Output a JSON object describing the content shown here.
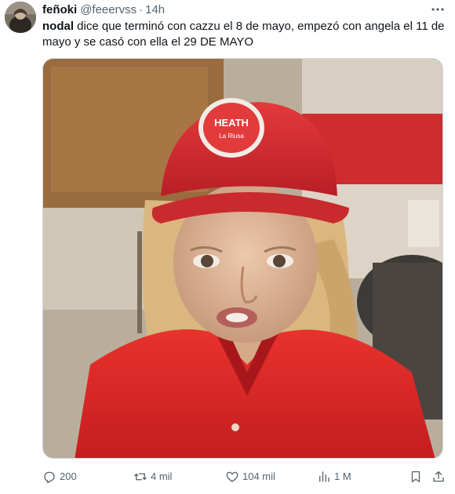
{
  "tweet": {
    "display_name": "feñoki",
    "handle": "@feeervss",
    "separator": "·",
    "time": "14h",
    "text_bold": "nodal",
    "text_rest": " dice que terminó con cazzu el 8 de mayo, empezó con angela el 11 de mayo y se casó con ella el 29 DE MAYO",
    "media_icon": "photo-meme",
    "cap_logo_line1": "HEATH",
    "cap_logo_line2": "La Riusa"
  },
  "actions": {
    "reply": {
      "icon": "reply-icon",
      "count": "200"
    },
    "repost": {
      "icon": "repost-icon",
      "count": "4 mil"
    },
    "like": {
      "icon": "heart-icon",
      "count": "104 mil"
    },
    "views": {
      "icon": "views-icon",
      "count": "1 M"
    },
    "bookmark": {
      "icon": "bookmark-icon"
    },
    "share": {
      "icon": "share-icon"
    }
  },
  "colors": {
    "text": "#0f1419",
    "muted": "#536471",
    "border": "#cfd9de",
    "shirt_red": "#e8322e"
  }
}
